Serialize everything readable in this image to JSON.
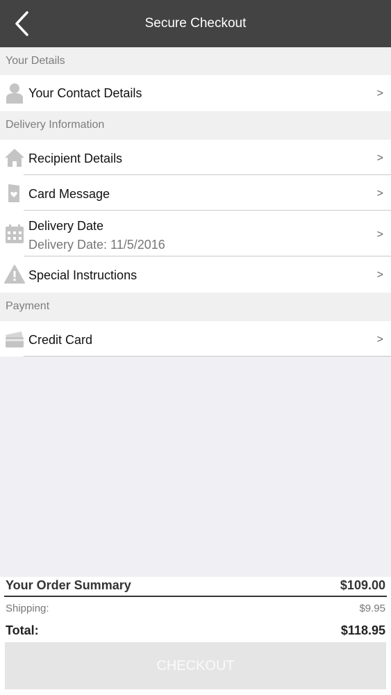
{
  "navbar": {
    "title": "Secure Checkout",
    "back_icon": "chevron-left-icon"
  },
  "sections": {
    "details": "Your Details",
    "delivery": "Delivery Information",
    "payment": "Payment"
  },
  "rows": {
    "contact": {
      "label": "Your Contact Details",
      "icon": "person-icon",
      "chevron": ">"
    },
    "recipient": {
      "label": "Recipient Details",
      "icon": "house-icon",
      "chevron": ">"
    },
    "card_message": {
      "label": "Card Message",
      "icon": "card-heart-icon",
      "chevron": ">"
    },
    "delivery_date": {
      "label": "Delivery Date",
      "value": "Delivery Date: 11/5/2016",
      "icon": "calendar-icon",
      "chevron": ">"
    },
    "special": {
      "label": "Special Instructions",
      "icon": "warning-icon",
      "chevron": ">"
    },
    "credit_card": {
      "label": "Credit Card",
      "icon": "credit-card-icon",
      "chevron": ">"
    }
  },
  "summary": {
    "title": "Your Order Summary",
    "subtotal": "$109.00",
    "shipping_label": "Shipping:",
    "shipping": "$9.95",
    "total_label": "Total:",
    "total": "$118.95"
  },
  "checkout_label": "CHECKOUT",
  "colors": {
    "navbar": "#434343",
    "background": "#efeff4",
    "icon": "#c4c4c4",
    "checkout_button": "#e5e5e5"
  }
}
